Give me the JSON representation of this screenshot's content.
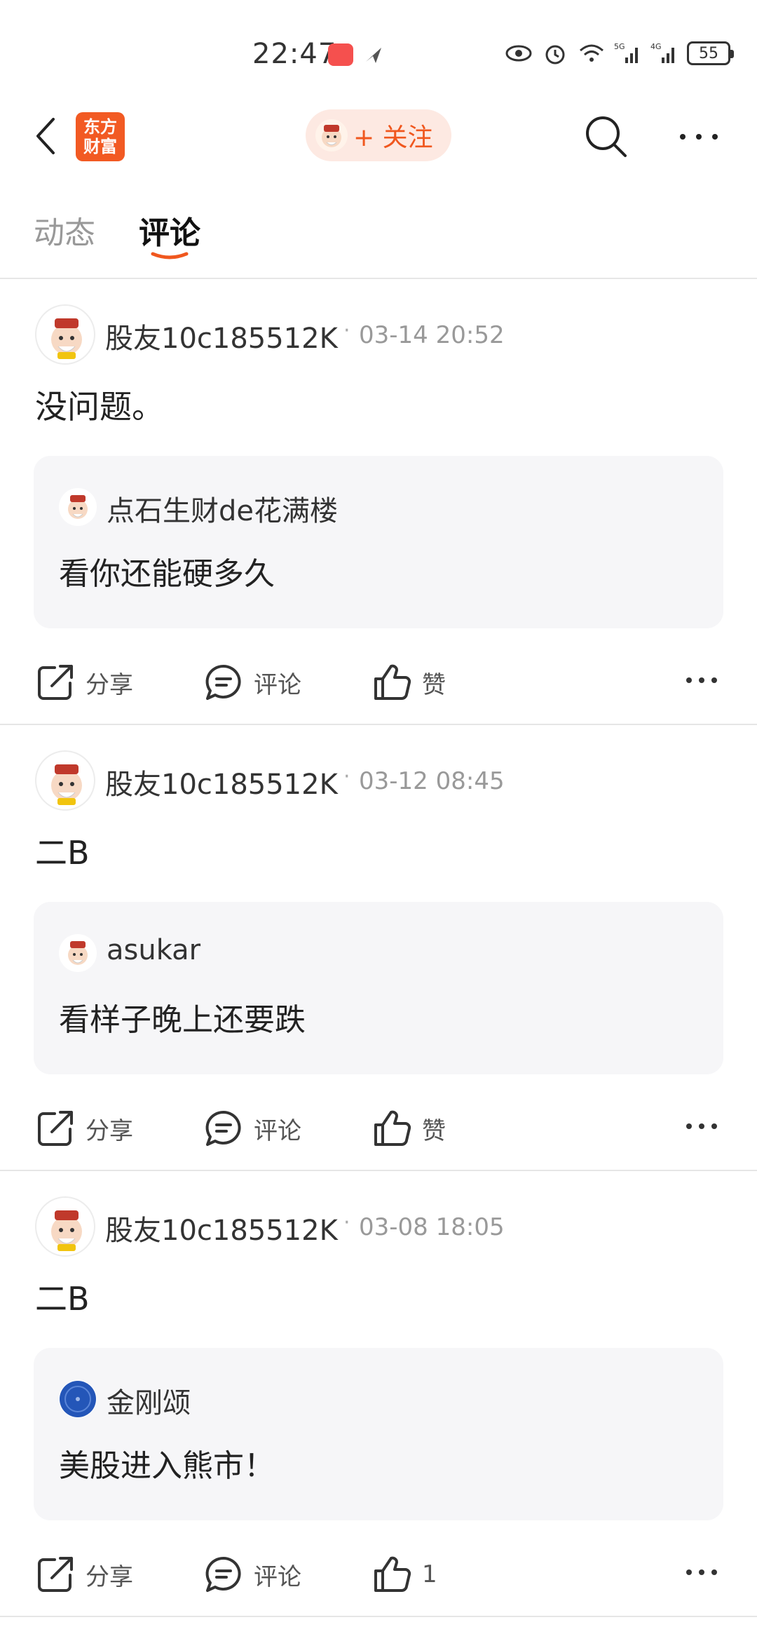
{
  "status_bar": {
    "time": "22:47",
    "battery": "55"
  },
  "header": {
    "logo_line1": "东方",
    "logo_line2": "财富",
    "follow_label": "+ 关注"
  },
  "tabs": {
    "dynamic": "动态",
    "comments": "评论"
  },
  "comments": [
    {
      "user": "股友10c185512K",
      "time": "03-14 20:52",
      "text": "没问题。",
      "quote_user": "点石生财de花满楼",
      "quote_text": "看你还能硬多久",
      "share": "分享",
      "comment": "评论",
      "like": "赞"
    },
    {
      "user": "股友10c185512K",
      "time": "03-12 08:45",
      "text": "二B",
      "quote_user": "asukar",
      "quote_text": "看样子晚上还要跌",
      "share": "分享",
      "comment": "评论",
      "like": "赞"
    },
    {
      "user": "股友10c185512K",
      "time": "03-08 18:05",
      "text": "二B",
      "quote_user": "金刚颂",
      "quote_text": "美股进入熊市！",
      "share": "分享",
      "comment": "评论",
      "like": "1"
    }
  ],
  "colors": {
    "accent": "#f0571e",
    "logo_bg": "#f25a23",
    "follow_bg": "#fde9e2",
    "quote_bg": "#f6f6f8"
  },
  "icons": [
    "back-icon",
    "search-icon",
    "more-icon",
    "share-icon",
    "comment-icon",
    "like-icon"
  ]
}
